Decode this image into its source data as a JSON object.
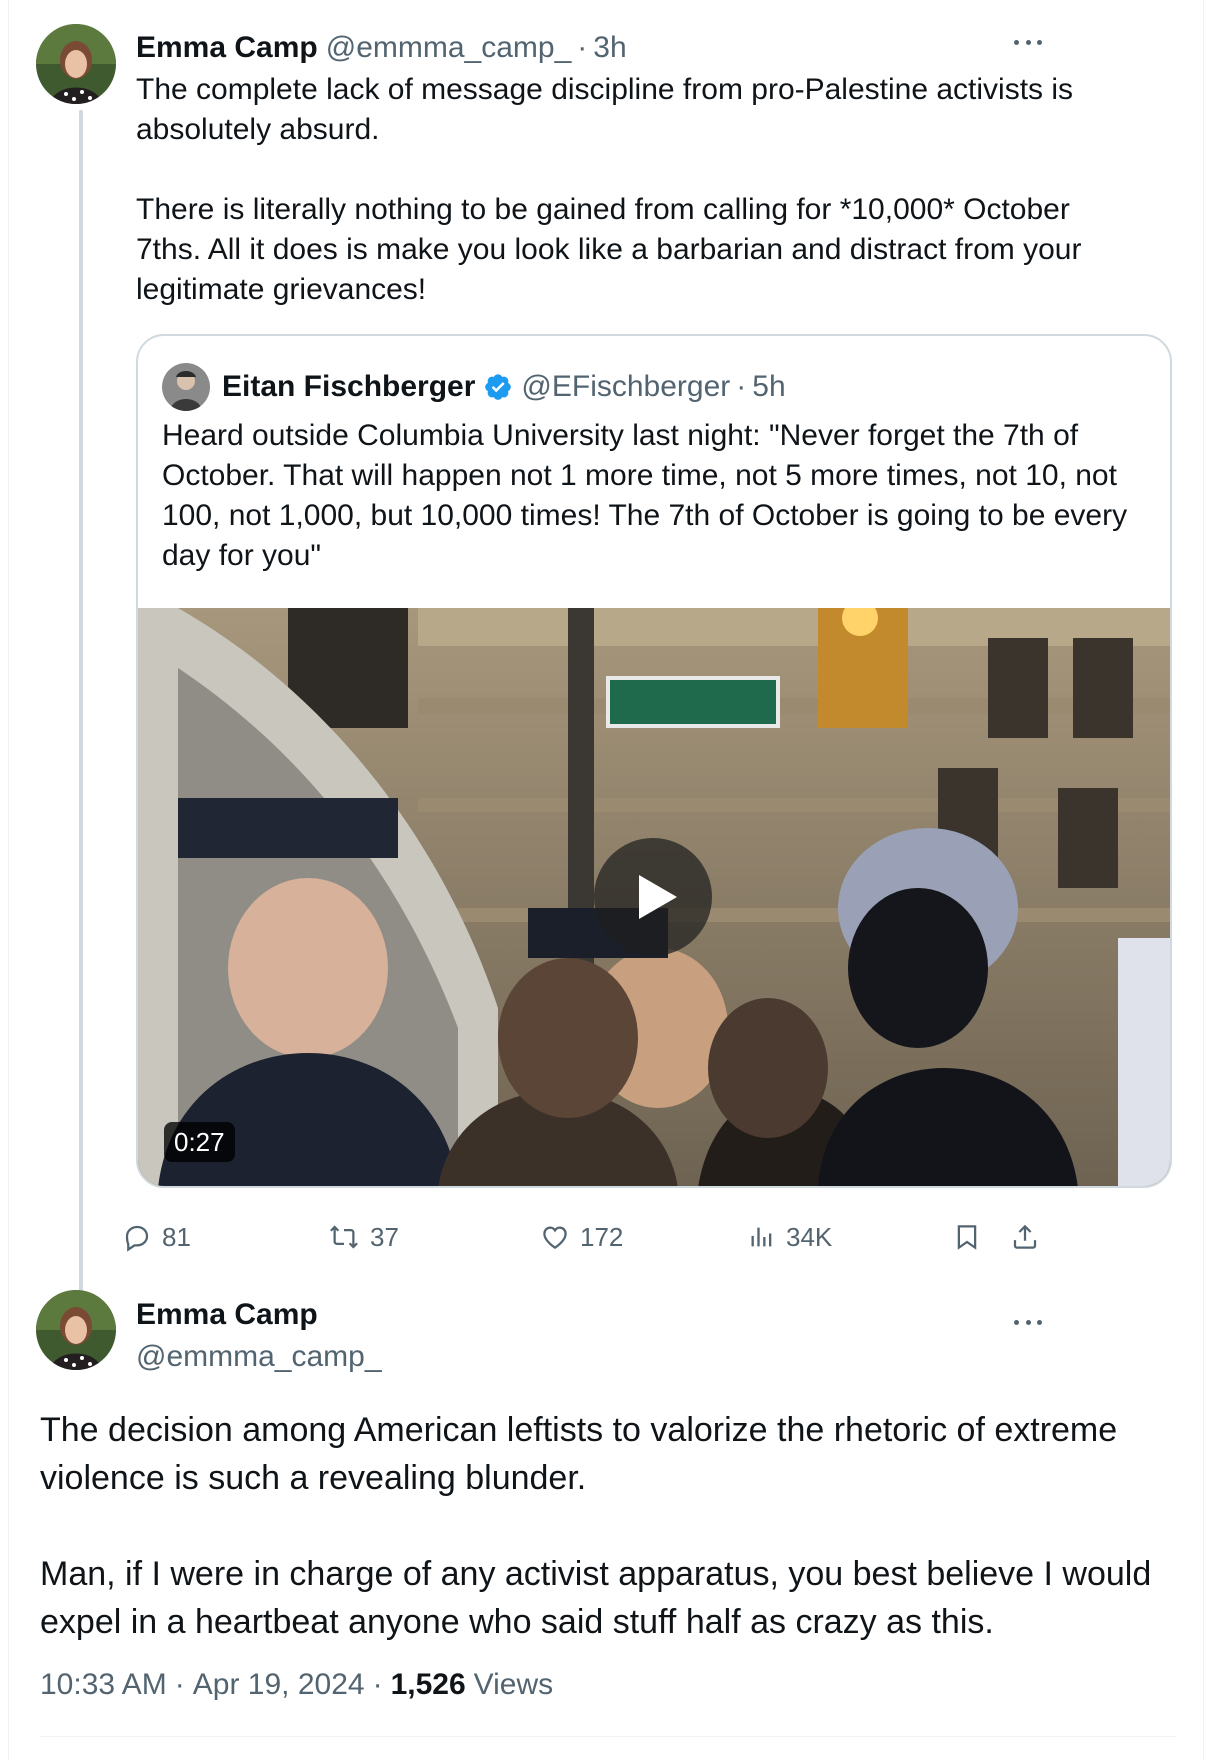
{
  "colors": {
    "text_primary": "#0f1419",
    "text_secondary": "#536471",
    "border": "#cfd9de",
    "verified_blue": "#1d9bf0"
  },
  "tweet1": {
    "author_name": "Emma Camp",
    "author_handle": "@emmma_camp_",
    "separator": "·",
    "time": "3h",
    "text": "The complete lack of message discipline from pro-Palestine activists is absolutely absurd.\n\nThere is literally nothing to be gained from calling for *10,000* October 7ths. All it does is make you look like a barbarian and distract from your legitimate grievances!",
    "avatar_icon": "profile-photo"
  },
  "quote": {
    "author_name": "Eitan Fischberger",
    "verified_icon": "verified-badge-icon",
    "author_handle": "@EFischberger",
    "separator": "·",
    "time": "5h",
    "text": "Heard outside Columbia University last night: \"Never forget the 7th of October. That will happen not 1 more time, not 5 more times, not 10, not 100, not 1,000, but 10,000 times! The 7th of October is going to be every day for you\"",
    "video": {
      "duration": "0:27",
      "play_icon": "play-icon"
    }
  },
  "actions": {
    "replies": "81",
    "reposts": "37",
    "likes": "172",
    "views": "34K",
    "icons": [
      "reply-icon",
      "repost-icon",
      "like-icon",
      "views-icon",
      "bookmark-icon",
      "share-icon"
    ]
  },
  "tweet2": {
    "author_name": "Emma Camp",
    "author_handle": "@emmma_camp_",
    "text": "The decision among American leftists to valorize the rhetoric of extreme violence is such a revealing blunder.\n\nMan, if I were in charge of any activist apparatus, you best believe I would expel in a heartbeat anyone who said stuff half as crazy as this.",
    "time": "10:33 AM",
    "separator": "·",
    "date": "Apr 19, 2024",
    "views_count": "1,526",
    "views_label": "Views"
  }
}
